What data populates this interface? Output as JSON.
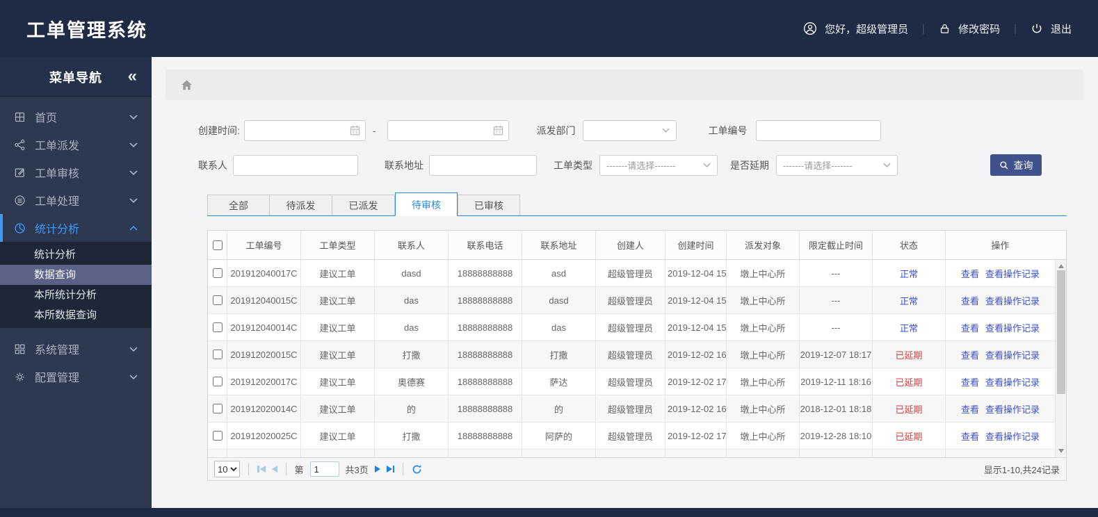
{
  "app": {
    "title": "工单管理系统"
  },
  "topbar": {
    "greeting": "您好，超级管理员",
    "change_password": "修改密码",
    "logout": "退出",
    "separator": "|"
  },
  "sidebar": {
    "header": "菜单导航",
    "collapse_icon": "«",
    "items": [
      {
        "label": "首页",
        "icon": "dashboard-grid"
      },
      {
        "label": "工单派发",
        "icon": "share-nodes"
      },
      {
        "label": "工单审核",
        "icon": "edit-square"
      },
      {
        "label": "工单处理",
        "icon": "process-circle"
      },
      {
        "label": "统计分析",
        "icon": "pie-chart",
        "active": true,
        "expanded": true,
        "children": [
          "统计分析",
          "数据查询",
          "本所统计分析",
          "本所数据查询"
        ],
        "selected_child": "数据查询"
      },
      {
        "label": "系统管理",
        "icon": "grid-squares"
      },
      {
        "label": "配置管理",
        "icon": "gear"
      }
    ]
  },
  "filters": {
    "create_time_label": "创建时间:",
    "range_separator": "-",
    "dispatch_dept_label": "派发部门",
    "order_no_label": "工单编号",
    "contact_label": "联系人",
    "address_label": "联系地址",
    "order_type_label": "工单类型",
    "delay_label": "是否延期",
    "select_placeholder": "-------请选择-------",
    "search_button": "查询"
  },
  "tabs": {
    "items": [
      "全部",
      "待派发",
      "已派发",
      "待审核",
      "已审核"
    ],
    "active_index": 3
  },
  "table": {
    "columns": [
      "工单编号",
      "工单类型",
      "联系人",
      "联系电话",
      "联系地址",
      "创建人",
      "创建时间",
      "派发对象",
      "限定截止时间",
      "状态",
      "操作"
    ],
    "actions": [
      "查看",
      "查看操作记录"
    ],
    "rows": [
      {
        "order_no": "201912040017C",
        "type": "建议工单",
        "contact": "dasd",
        "phone": "18888888888",
        "address": "asd",
        "creator": "超级管理员",
        "created": "2019-12-04 15",
        "target": "墩上中心所",
        "deadline": "---",
        "status": "正常",
        "status_type": "normal"
      },
      {
        "order_no": "201912040015C",
        "type": "建议工单",
        "contact": "das",
        "phone": "18888888888",
        "address": "dasd",
        "creator": "超级管理员",
        "created": "2019-12-04 15",
        "target": "墩上中心所",
        "deadline": "---",
        "status": "正常",
        "status_type": "normal"
      },
      {
        "order_no": "201912040014C",
        "type": "建议工单",
        "contact": "das",
        "phone": "18888888888",
        "address": "das",
        "creator": "超级管理员",
        "created": "2019-12-04 15",
        "target": "墩上中心所",
        "deadline": "---",
        "status": "正常",
        "status_type": "normal"
      },
      {
        "order_no": "201912020015C",
        "type": "建议工单",
        "contact": "打撒",
        "phone": "18888888888",
        "address": "打撒",
        "creator": "超级管理员",
        "created": "2019-12-02 16",
        "target": "墩上中心所",
        "deadline": "2019-12-07 18:17",
        "status": "已延期",
        "status_type": "delayed"
      },
      {
        "order_no": "201912020017C",
        "type": "建议工单",
        "contact": "奥德赛",
        "phone": "18888888888",
        "address": "萨达",
        "creator": "超级管理员",
        "created": "2019-12-02 17",
        "target": "墩上中心所",
        "deadline": "2019-12-11 18:16",
        "status": "已延期",
        "status_type": "delayed"
      },
      {
        "order_no": "201912020014C",
        "type": "建议工单",
        "contact": "的",
        "phone": "18888888888",
        "address": "的",
        "creator": "超级管理员",
        "created": "2019-12-02 16",
        "target": "墩上中心所",
        "deadline": "2018-12-01 18:18",
        "status": "已延期",
        "status_type": "delayed"
      },
      {
        "order_no": "201912020025C",
        "type": "建议工单",
        "contact": "打撒",
        "phone": "18888888888",
        "address": "阿萨的",
        "creator": "超级管理员",
        "created": "2019-12-02 17",
        "target": "墩上中心所",
        "deadline": "2019-12-28 18:10",
        "status": "已延期",
        "status_type": "delayed"
      }
    ]
  },
  "pagination": {
    "page_size": "10",
    "page_prefix": "第",
    "current_page": "1",
    "total_pages": "共3页",
    "summary": "显示1-10,共24记录"
  },
  "colors": {
    "navbar": "#1f2a44",
    "sidebar": "#2d3950",
    "sidebar-active": "#3f9bf8",
    "submenu-bg": "#1d2737",
    "submenu-selected": "#5a6288",
    "accent-tab": "#2a8bd6",
    "link": "#3a50d0",
    "status-normal": "#3a50d0",
    "status-delayed": "#e23b3b",
    "search-button": "#40518c",
    "pager-arrow": "#1a82e2"
  }
}
